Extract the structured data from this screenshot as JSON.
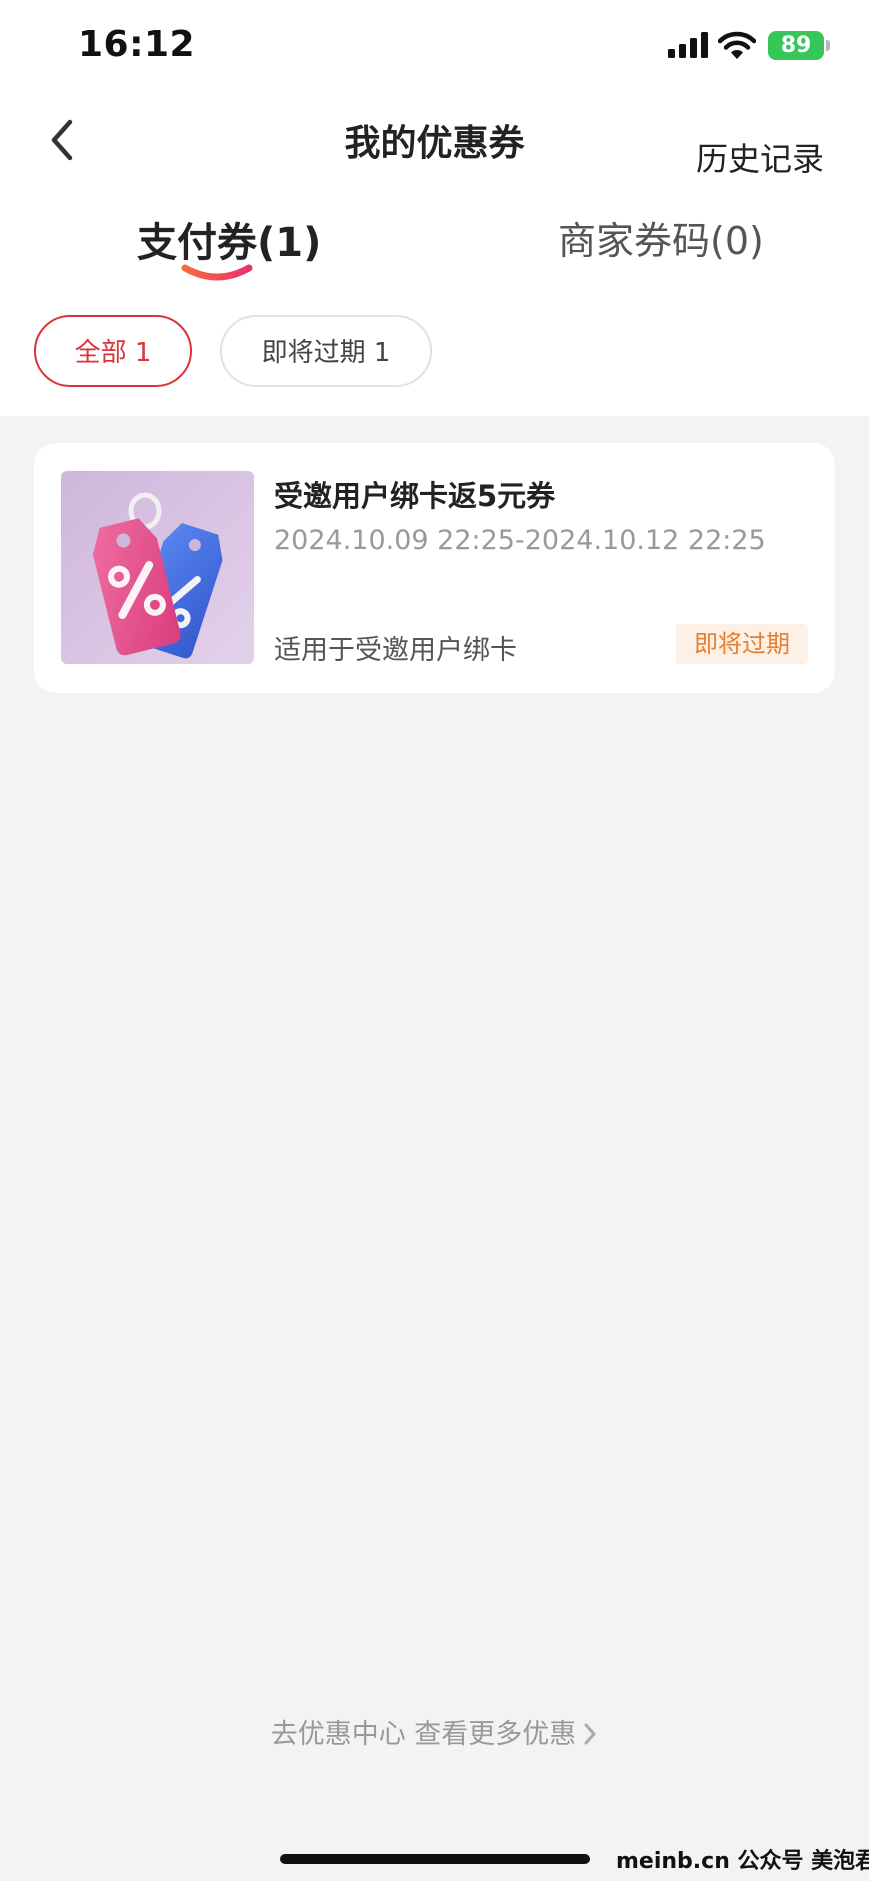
{
  "status_bar": {
    "time": "16:12",
    "battery": "89"
  },
  "nav": {
    "title": "我的优惠券",
    "history": "历史记录"
  },
  "tabs": [
    {
      "label": "支付券(1)",
      "active": true
    },
    {
      "label": "商家券码(0)",
      "active": false
    }
  ],
  "filters": [
    {
      "label": "全部 1",
      "selected": true
    },
    {
      "label": "即将过期 1",
      "selected": false
    }
  ],
  "coupons": [
    {
      "title": "受邀用户绑卡返5元券",
      "period": "2024.10.09 22:25-2024.10.12 22:25",
      "scope": "适用于受邀用户绑卡",
      "badge": "即将过期"
    }
  ],
  "footer": {
    "more_link": "去优惠中心 查看更多优惠"
  },
  "watermark": "meinb.cn  公众号 美泡君",
  "colors": {
    "accent_red": "#d9343a",
    "badge_orange": "#e77f2e",
    "battery_green": "#35c759"
  }
}
